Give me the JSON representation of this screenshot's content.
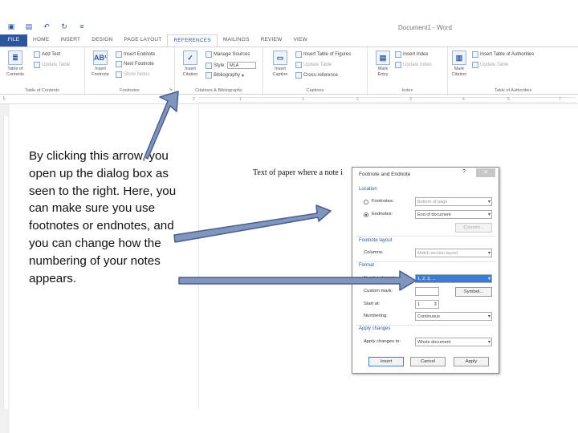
{
  "app": {
    "qat_icons": [
      "word-icon",
      "save-icon",
      "undo-icon",
      "redo-icon",
      "customize-icon"
    ],
    "title": "Document1 - Word"
  },
  "tabs": [
    "FILE",
    "HOME",
    "INSERT",
    "DESIGN",
    "PAGE LAYOUT",
    "REFERENCES",
    "MAILINGS",
    "REVIEW",
    "VIEW"
  ],
  "ribbon": {
    "toc": {
      "big_label_1": "Table of",
      "big_label_2": "Contents",
      "add_text": "Add Text",
      "update_table": "Update Table",
      "group": "Table of Contents"
    },
    "footnotes": {
      "big_label_1": "Insert",
      "big_label_2": "Footnote",
      "insert_endnote": "Insert Endnote",
      "next_footnote": "Next Footnote",
      "show_notes": "Show Notes",
      "group": "Footnotes"
    },
    "citations": {
      "big_label_1": "Insert",
      "big_label_2": "Citation",
      "manage_sources": "Manage Sources",
      "style_label": "Style:",
      "style_value": "MLA",
      "bibliography": "Bibliography",
      "group": "Citations & Bibliography"
    },
    "captions": {
      "big_label_1": "Insert",
      "big_label_2": "Caption",
      "insert_table_of_figures": "Insert Table of Figures",
      "update_table": "Update Table",
      "cross_reference": "Cross-reference",
      "group": "Captions"
    },
    "index": {
      "big_label_1": "Mark",
      "big_label_2": "Entry",
      "insert_index": "Insert Index",
      "update_index": "Update Index",
      "group": "Index"
    },
    "toa": {
      "big_label_1": "Mark",
      "big_label_2": "Citation",
      "insert_toa": "Insert Table of Authorities",
      "update_table": "Update Table",
      "group": "Table of Authorities"
    }
  },
  "ruler": {
    "corner": "L",
    "numbers": [
      "2",
      "1",
      "1",
      "2",
      "3",
      "4",
      "5",
      "6",
      "7"
    ]
  },
  "callout": "By clicking this arrow, you open up the dialog box as seen to the right. Here, you can make sure you use footnotes or endnotes, and you can change how the numbering of your notes appears.",
  "document_text": "Text of paper where a note i",
  "dialog": {
    "title": "Footnote and Endnote",
    "help": "?",
    "close": "✕",
    "location_label": "Location",
    "footnotes_label": "Footnotes:",
    "footnotes_value": "Bottom of page",
    "endnotes_label": "Endnotes:",
    "endnotes_value": "End of document",
    "convert_button": "Convert...",
    "layout_label": "Footnote layout",
    "columns_label": "Columns:",
    "columns_value": "Match section layout",
    "format_label": "Format",
    "number_format_label": "Number format:",
    "number_format_value": "1, 2, 3, ...",
    "custom_mark_label": "Custom mark:",
    "symbol_button": "Symbol...",
    "start_at_label": "Start at:",
    "start_at_value": "1",
    "numbering_label": "Numbering:",
    "numbering_value": "Continuous",
    "apply_changes_label": "Apply changes",
    "apply_to_label": "Apply changes to:",
    "apply_to_value": "Whole document",
    "insert_button": "Insert",
    "cancel_button": "Cancel",
    "apply_button": "Apply"
  },
  "colors": {
    "accent": "#2b579a",
    "arrow_fill": "#8096bf",
    "arrow_stroke": "#4a5f8a"
  }
}
